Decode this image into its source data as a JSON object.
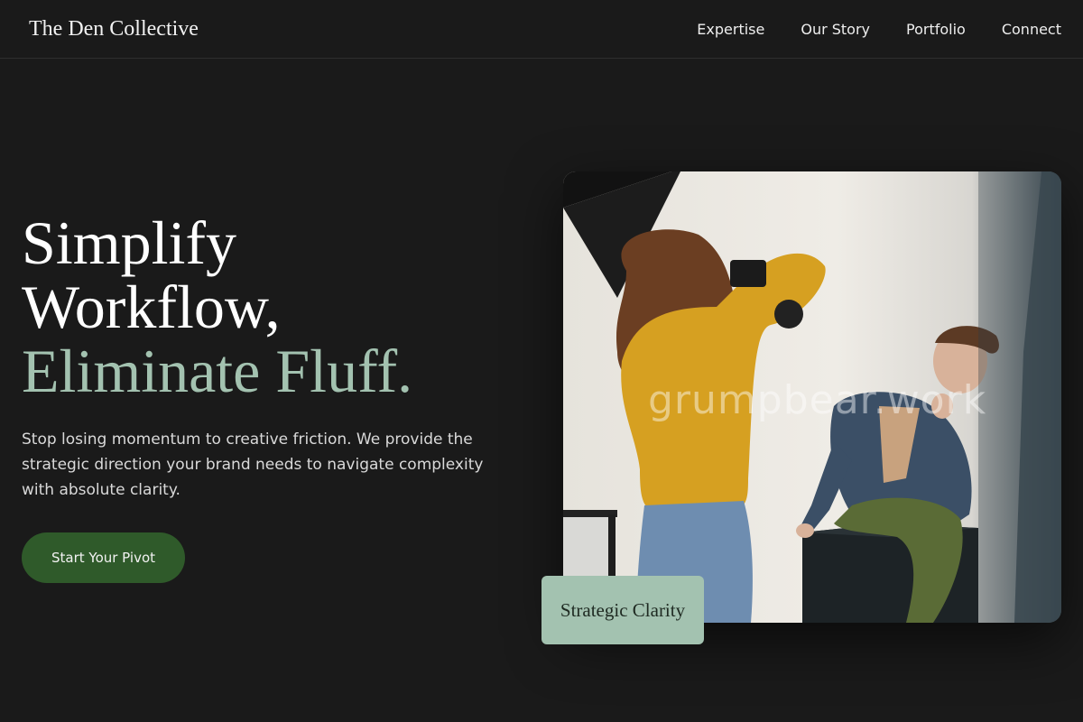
{
  "nav": {
    "brand": "The Den Collective",
    "links": [
      "Expertise",
      "Our Story",
      "Portfolio",
      "Connect"
    ]
  },
  "hero": {
    "headline_line1": "Simplify",
    "headline_line2": "Workflow,",
    "headline_accent": "Eliminate Fluff.",
    "subtext": "Stop losing momentum to creative friction. We provide the strategic direction your brand needs to navigate complexity with absolute clarity.",
    "cta_label": "Start Your Pivot"
  },
  "photo": {
    "watermark": "grumpbear.work"
  },
  "badge": {
    "label": "Strategic Clarity"
  },
  "colors": {
    "background": "#1a1a1a",
    "accent_text": "#a3c2b0",
    "cta_bg": "#2f5a2a",
    "badge_bg": "#a3c2b0"
  }
}
